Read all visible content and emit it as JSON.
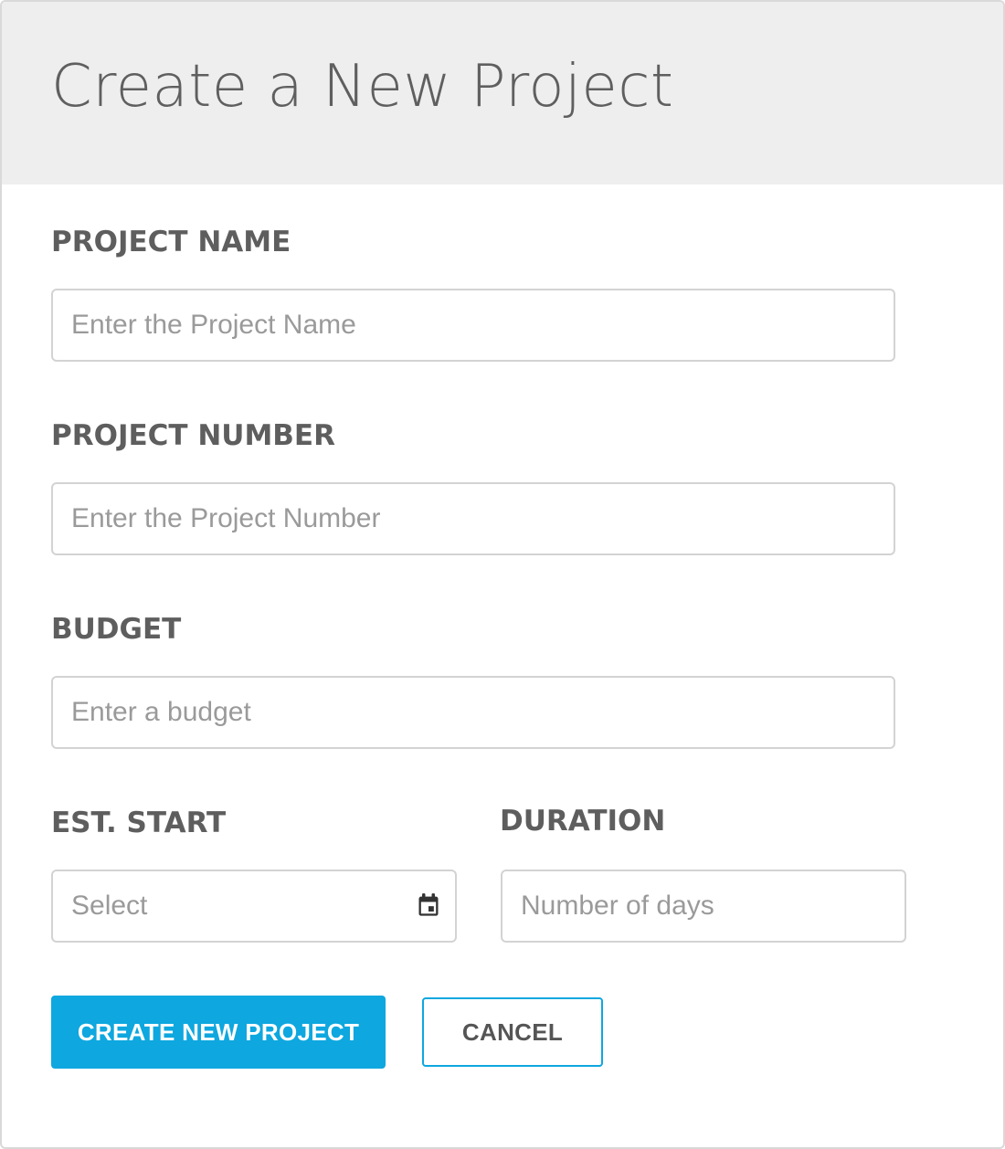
{
  "header": {
    "title": "Create a New Project"
  },
  "form": {
    "project_name": {
      "label": "PROJECT NAME",
      "placeholder": "Enter the Project Name",
      "value": ""
    },
    "project_number": {
      "label": "PROJECT NUMBER",
      "placeholder": "Enter the Project Number",
      "value": ""
    },
    "budget": {
      "label": "BUDGET",
      "placeholder": "Enter a budget",
      "value": ""
    },
    "est_start": {
      "label": "EST. START",
      "placeholder": "Select",
      "value": "",
      "icon": "calendar-icon"
    },
    "duration": {
      "label": "DURATION",
      "placeholder": "Number of days",
      "value": ""
    }
  },
  "actions": {
    "create_label": "CREATE NEW PROJECT",
    "cancel_label": "CANCEL"
  },
  "colors": {
    "accent": "#0ea7df",
    "header_bg": "#eeeeee",
    "label_text": "#5e5e5e",
    "placeholder_text": "#9a9a9a",
    "input_border": "#d3d3d3"
  }
}
